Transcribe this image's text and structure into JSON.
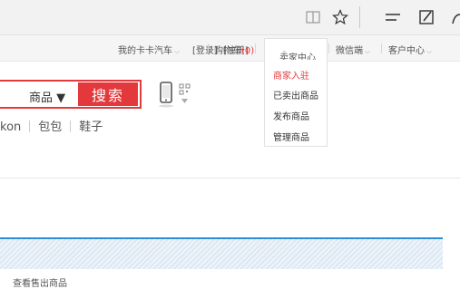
{
  "toolbar": {
    "icons": [
      "reading-view-icon",
      "favorite-star-icon",
      "hub-menu-icon",
      "web-note-icon",
      "share-icon"
    ]
  },
  "topnav": {
    "login": "[登录]",
    "register": "[注册]",
    "my_account": "我的卡卡汽车",
    "cart_label": "购物车",
    "cart_count": "0",
    "seller_center": "卖家中心",
    "wechat": "微信端",
    "customer_center": "客户中心"
  },
  "seller_dropdown": {
    "items": [
      "商家入驻",
      "已卖出商品",
      "发布商品",
      "管理商品"
    ]
  },
  "search": {
    "category": "商品 ▼",
    "button": "搜索"
  },
  "hot_words": [
    "kon",
    "包包",
    "鞋子"
  ],
  "cut_text": "查看售出商品",
  "colors": {
    "accent": "#e4393c",
    "stripe_border": "#2a8fd6"
  }
}
